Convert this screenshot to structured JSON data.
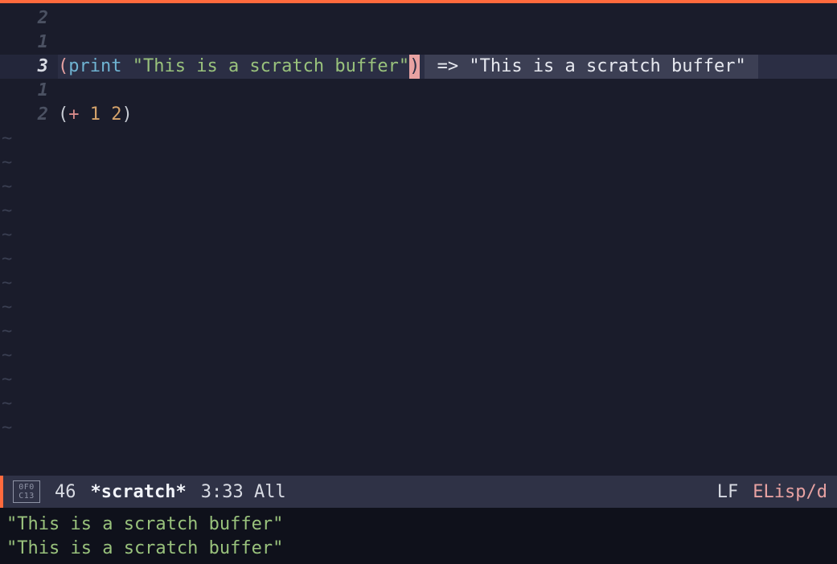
{
  "lines": {
    "l1": {
      "gutter": "2",
      "text": ""
    },
    "l2": {
      "gutter": "1",
      "text": ""
    },
    "l3": {
      "gutter": "3",
      "func": "print",
      "string": "\"This is a scratch buffer\"",
      "overlay_arrow": " => ",
      "overlay_result": "\"This is a scratch buffer\""
    },
    "l4": {
      "gutter": "1",
      "text": ""
    },
    "l5": {
      "gutter": "2",
      "op": "+",
      "arg1": "1",
      "arg2": "2"
    }
  },
  "tilde": "~",
  "modeline": {
    "evil_top": "0F0",
    "evil_bot": "C13",
    "col": "46",
    "buffer": "*scratch*",
    "position": "3:33 All",
    "eol": "LF",
    "mode": "ELisp/d"
  },
  "echo": {
    "line1": "\"This is a scratch buffer\"",
    "line2": "\"This is a scratch buffer\""
  }
}
